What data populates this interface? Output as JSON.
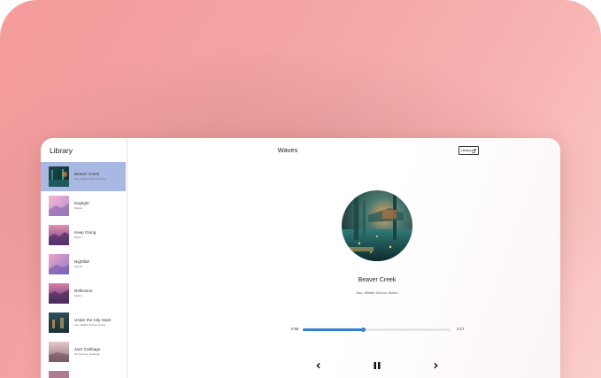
{
  "sidebar": {
    "title": "Library",
    "tracks": [
      {
        "title": "Beaver Creek",
        "artist": "Aso, Middle School, Aviino",
        "selected": true
      },
      {
        "title": "Daylight",
        "artist": "Nguza"
      },
      {
        "title": "Keep Going",
        "artist": "Swørn"
      },
      {
        "title": "Nightfall",
        "artist": "Nguza"
      },
      {
        "title": "Reflection",
        "artist": "Swørn"
      },
      {
        "title": "Under the City Stars",
        "artist": "Aso, Middle School, Aviino"
      },
      {
        "title": "Jazz Cabbage",
        "artist": "Ice Cuming, Jenarsia"
      }
    ]
  },
  "header": {
    "title": "Waves",
    "library_button": "Library"
  },
  "now_playing": {
    "title": "Beaver Creek",
    "artist": "Aso, Middle School, Aviino",
    "current_time": "0:56",
    "duration": "2:17",
    "progress": 0.41
  },
  "controls": {
    "prev_icon": "chevron-left-icon",
    "pause_icon": "pause-icon",
    "next_icon": "chevron-right-icon"
  },
  "colors": {
    "accent": "#2f7ed8",
    "selected_row": "#a9b7e3",
    "background_gradient_start": "#f59c9c",
    "background_gradient_end": "#fbcfcc"
  }
}
